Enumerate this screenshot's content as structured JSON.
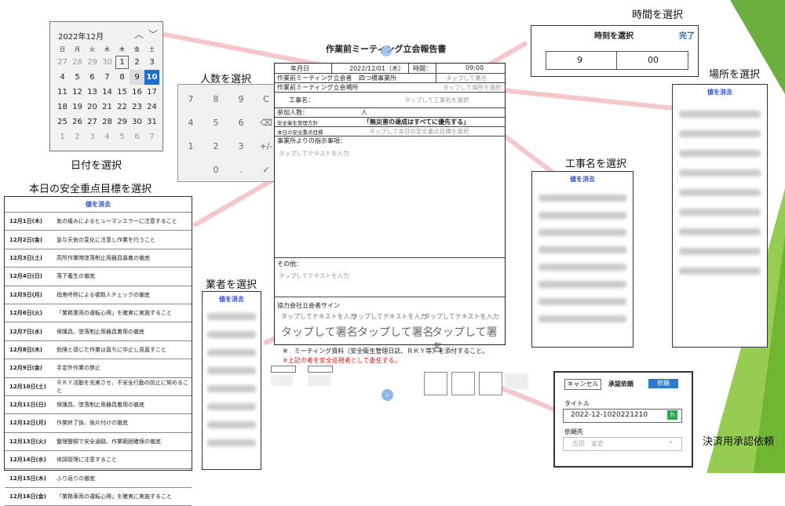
{
  "captions": {
    "time": "時間を選択",
    "place": "場所を選択",
    "people": "人数を選択",
    "date": "日付を選択",
    "goal": "本日の安全重点目標を選択",
    "contractor": "業者を選択",
    "project": "工事名を選択",
    "approval": "決済用承認依頼"
  },
  "calendar": {
    "month": "2022年12月",
    "weekdays": [
      "日",
      "月",
      "火",
      "水",
      "木",
      "金",
      "土"
    ],
    "weeks": [
      [
        "27",
        "28",
        "29",
        "30",
        "1",
        "2",
        "3"
      ],
      [
        "4",
        "5",
        "6",
        "7",
        "8",
        "9",
        "10"
      ],
      [
        "11",
        "12",
        "13",
        "14",
        "15",
        "16",
        "17"
      ],
      [
        "18",
        "19",
        "20",
        "21",
        "22",
        "23",
        "24"
      ],
      [
        "25",
        "26",
        "27",
        "28",
        "29",
        "30",
        "31"
      ],
      [
        "1",
        "2",
        "3",
        "4",
        "5",
        "6",
        "7"
      ]
    ],
    "today": "1",
    "selected": "10"
  },
  "keypad": {
    "keys": [
      "7",
      "8",
      "9",
      "C",
      "4",
      "5",
      "6",
      "⌫",
      "1",
      "2",
      "3",
      "+/-",
      "",
      "0",
      ".",
      "✓"
    ]
  },
  "time_picker": {
    "title": "時刻を選択",
    "done": "完了",
    "hour": "9",
    "minute": "00"
  },
  "clear_label": "値を消去",
  "form": {
    "title": "作業前ミーティング立会報告書",
    "date_label": "年月日",
    "date_value": "2022/12/01（木）",
    "time_label": "時間：",
    "time_value": "09:00",
    "company_label": "作業前ミーティング立会者",
    "company_value": "四つ橋事業所",
    "company_tap": "タップして署名",
    "place_label": "作業前ミーティング立会場所",
    "place_tap": "タップして場所を選択",
    "project_label": "工事名：",
    "project_tap": "タップして工事名を選択",
    "people_label": "参加人数：",
    "people_value": "人",
    "policy_label": "安全衛生管理方針",
    "policy_value": "「無災害の達成はすべてに優先する」",
    "goal_label": "本日の安全重点目標",
    "goal_tap": "タップして本日の安全重点目標を選択",
    "instr_label": "事業所よりの指示事項：",
    "instr_tap": "タップしてテキストを入力",
    "other_label": "その他：",
    "other_tap": "タップしてテキストを入力",
    "sign_label": "協力会社立会者サイン",
    "sign_text_tap": "タップしてテキストを入力",
    "sign_tap": "タップして署名",
    "note1": "※　ミーティング資料（安全衛生管理日誌、ＲＫＹ等）を添付すること。",
    "note2": "※上記の者を安全巡視者として委任する。"
  },
  "goals": [
    {
      "date": "12月1日(木)",
      "text": "気の緩みによるヒューマンエラーに注意すること"
    },
    {
      "date": "12月2日(金)",
      "text": "急な天気の変化に注意し作業を行うこと"
    },
    {
      "date": "12月3日(土)",
      "text": "高所作業時墜落制止用器具装着の徹底"
    },
    {
      "date": "12月4日(日)",
      "text": "落下養生の徹底"
    },
    {
      "date": "12月5日(月)",
      "text": "指差呼称による複数人チェックの徹底"
    },
    {
      "date": "12月6日(火)",
      "text": "「業務重両の運転心得」を確実に実施すること"
    },
    {
      "date": "12月7日(水)",
      "text": "保護具、墜落制止用器具着用の徹底"
    },
    {
      "date": "12月8日(木)",
      "text": "危険と感じた作業は直ちに中止し見直すこと"
    },
    {
      "date": "12月9日(金)",
      "text": "手定外作業の禁止"
    },
    {
      "date": "12月10日(土)",
      "text": "ＲＫＹ活動を充実させ、不安全行動の防止に努めること"
    },
    {
      "date": "12月11日(日)",
      "text": "保護具、墜落制止用器具着用の徹底"
    },
    {
      "date": "12月12日(月)",
      "text": "作業終了後、後片付けの徹底"
    },
    {
      "date": "12月13日(火)",
      "text": "整理整頓で安全通路、作業範囲確保の徹底"
    },
    {
      "date": "12月14日(水)",
      "text": "体調管理に注意すること"
    },
    {
      "date": "12月15日(木)",
      "text": "ふり返りの徹底"
    },
    {
      "date": "12月16日(金)",
      "text": "「業務車両の運転心得」を確実に実施すること"
    }
  ],
  "approval": {
    "cancel": "キャンセル",
    "heading": "承認依頼",
    "submit": "依頼",
    "title_label": "タイトル",
    "title_value": "2022-12-1020221210",
    "requestee_label": "依頼先",
    "requestee_value": "吉田　富史"
  },
  "colors": {
    "accent_blue": "#1a6fd4",
    "callout_pink": "#f4bcc2",
    "green_deco": "#7bbf2a",
    "red_note": "#e02020"
  }
}
